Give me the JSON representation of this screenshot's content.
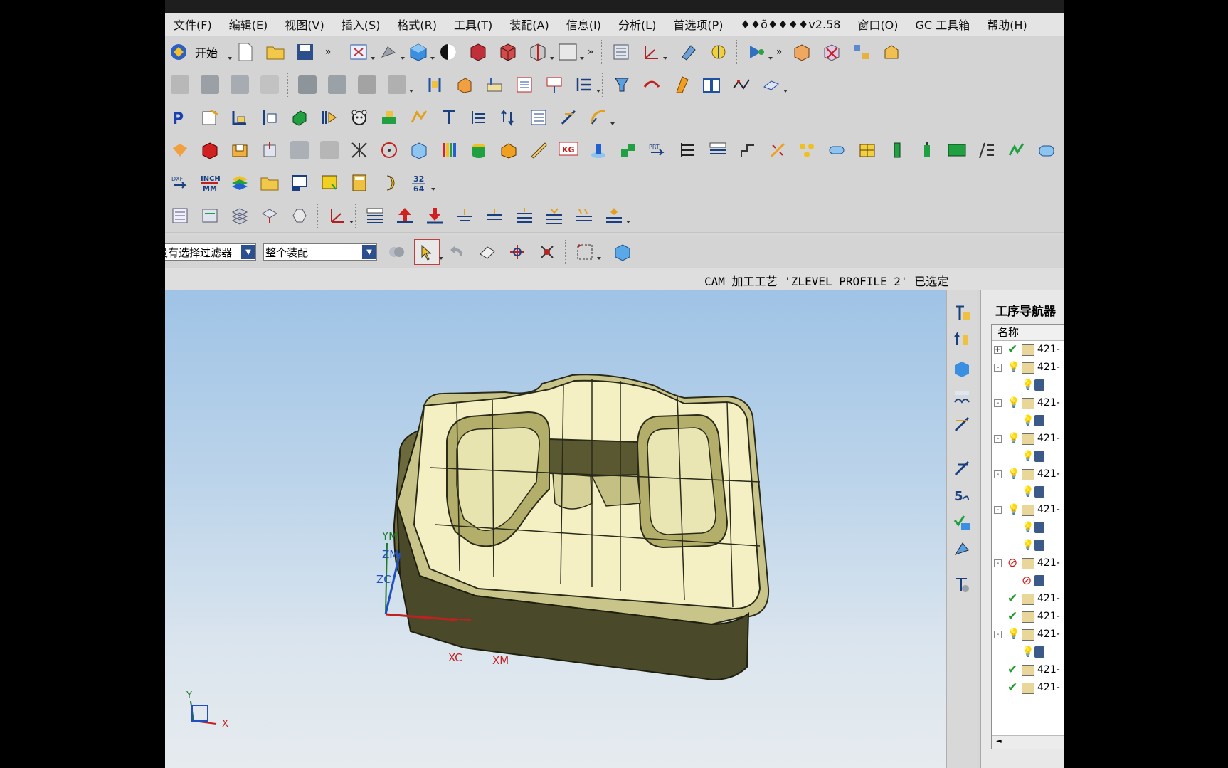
{
  "menu": [
    "文件(F)",
    "编辑(E)",
    "视图(V)",
    "插入(S)",
    "格式(R)",
    "工具(T)",
    "装配(A)",
    "信息(I)",
    "分析(L)",
    "首选项(P)",
    "♦♦õ♦♦♦♦v2.58",
    "窗口(O)",
    "GC 工具箱",
    "帮助(H)"
  ],
  "toolbar": {
    "start_label": "开始",
    "overflow_glyph": "»",
    "inch_mm_top": "INCH",
    "inch_mm_bottom": "MM",
    "fraction_top": "32",
    "fraction_bottom": "64",
    "kg_label": "KG",
    "prt_label": "PRT",
    "dxf_label": "DXF"
  },
  "filter": {
    "type_filter": "没有选择过滤器",
    "scope": "整个装配"
  },
  "status": {
    "message": "CAM 加工工艺 'ZLEVEL_PROFILE_2' 已选定"
  },
  "viewport": {
    "wcs_labels": {
      "ym": "YM",
      "zm": "ZM",
      "zc": "ZC",
      "xc": "XC",
      "xm": "XM"
    },
    "triad_labels": {
      "y": "Y",
      "x": "X"
    },
    "part_color": "#e7e2a4"
  },
  "navigator": {
    "title": "工序导航器",
    "column_name": "名称",
    "rows": [
      {
        "expander": "+",
        "status": "check",
        "label": "421-"
      },
      {
        "expander": "-",
        "status": "bulb",
        "label": "421-"
      },
      {
        "expander": "",
        "status": "bulb",
        "label": ""
      },
      {
        "expander": "-",
        "status": "bulb",
        "label": "421-"
      },
      {
        "expander": "",
        "status": "bulb",
        "label": ""
      },
      {
        "expander": "-",
        "status": "bulb",
        "label": "421-"
      },
      {
        "expander": "",
        "status": "bulb",
        "label": ""
      },
      {
        "expander": "-",
        "status": "bulb",
        "label": "421-"
      },
      {
        "expander": "",
        "status": "bulb",
        "label": ""
      },
      {
        "expander": "-",
        "status": "bulb",
        "label": "421-"
      },
      {
        "expander": "",
        "status": "bulb",
        "label": ""
      },
      {
        "expander": "",
        "status": "bulb",
        "label": ""
      },
      {
        "expander": "-",
        "status": "blocked",
        "label": "421-"
      },
      {
        "expander": "",
        "status": "blocked",
        "label": ""
      },
      {
        "expander": "",
        "status": "check",
        "label": "421-"
      },
      {
        "expander": "",
        "status": "check",
        "label": "421-"
      },
      {
        "expander": "-",
        "status": "bulb",
        "label": "421-"
      },
      {
        "expander": "",
        "status": "bulb",
        "label": ""
      },
      {
        "expander": "",
        "status": "check",
        "label": "421-"
      },
      {
        "expander": "",
        "status": "check",
        "label": "421-"
      }
    ]
  },
  "colors": {
    "check": "#1f9b2e",
    "bulb": "#e8c21a",
    "blocked": "#d01818",
    "accent_blue": "#2b4f8f"
  }
}
